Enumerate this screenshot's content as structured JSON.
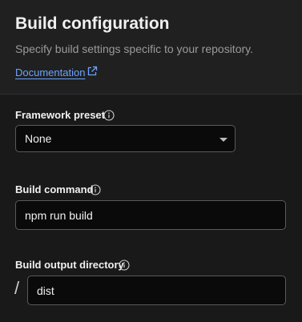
{
  "header": {
    "title": "Build configuration",
    "subtitle": "Specify build settings specific to your repository.",
    "documentation_link": "Documentation"
  },
  "fields": {
    "framework_preset": {
      "label": "Framework preset",
      "value": "None"
    },
    "build_command": {
      "label": "Build command",
      "value": "npm run build"
    },
    "build_output_directory": {
      "label": "Build output directory",
      "prefix": "/",
      "value": "dist"
    }
  },
  "icons": {
    "external_link": "external-link-icon",
    "info": "info-icon",
    "dropdown": "chevron-down-icon"
  },
  "colors": {
    "background": "#191919",
    "header_background": "#202020",
    "link": "#6aa3ff",
    "input_background": "#0a0a0a",
    "input_border": "#5a5a5a"
  }
}
